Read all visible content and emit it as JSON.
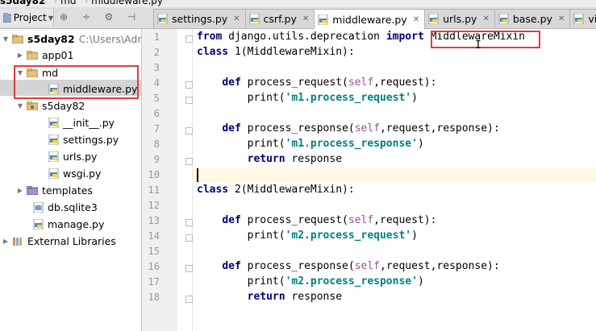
{
  "breadcrumb": [
    "s5day82",
    "md",
    "middleware.py"
  ],
  "project_panel": {
    "label": "Project",
    "tree": [
      {
        "name": "s5day82",
        "path": "C:\\Users\\Adm",
        "type": "project-root",
        "expanded": true
      },
      {
        "name": "app01",
        "type": "folder",
        "expanded": false
      },
      {
        "name": "md",
        "type": "folder",
        "expanded": true
      },
      {
        "name": "middleware.py",
        "type": "py",
        "selected": true
      },
      {
        "name": "s5day82",
        "type": "package",
        "expanded": true
      },
      {
        "name": "__init__.py",
        "type": "py"
      },
      {
        "name": "settings.py",
        "type": "py"
      },
      {
        "name": "urls.py",
        "type": "py"
      },
      {
        "name": "wsgi.py",
        "type": "py"
      },
      {
        "name": "templates",
        "type": "folder-purple",
        "expanded": false
      },
      {
        "name": "db.sqlite3",
        "type": "db"
      },
      {
        "name": "manage.py",
        "type": "py"
      },
      {
        "name": "External Libraries",
        "type": "libraries",
        "expanded": false
      }
    ]
  },
  "tabs": [
    {
      "label": "settings.py",
      "active": false
    },
    {
      "label": "csrf.py",
      "active": false
    },
    {
      "label": "middleware.py",
      "active": true
    },
    {
      "label": "urls.py",
      "active": false
    },
    {
      "label": "base.py",
      "active": false
    },
    {
      "label": "view",
      "active": false
    }
  ],
  "editor": {
    "line_numbers": [
      "1",
      "2",
      "3",
      "4",
      "5",
      "6",
      "7",
      "8",
      "9",
      "10",
      "11",
      "12",
      "13",
      "14",
      "15",
      "16",
      "17",
      "18"
    ],
    "lines": [
      "from django.utils.deprecation import MiddlewareMixin",
      "class M1(MiddlewareMixin):",
      "",
      "    def process_request(self,request):",
      "        print('m1.process_request')",
      "",
      "    def process_response(self,request,response):",
      "        print('m1.process_response')",
      "        return response",
      "",
      "class M2(MiddlewareMixin):",
      "",
      "    def process_request(self,request):",
      "        print('m2.process_request')",
      "",
      "    def process_response(self,request,response):",
      "        print('m2.process_response')",
      "        return response"
    ],
    "current_line": 10
  },
  "colors": {
    "keyword": "#000080",
    "string": "#008080",
    "self": "#94558d",
    "highlight_box": "#e03c3c",
    "selected_row": "#d4d4d4"
  }
}
